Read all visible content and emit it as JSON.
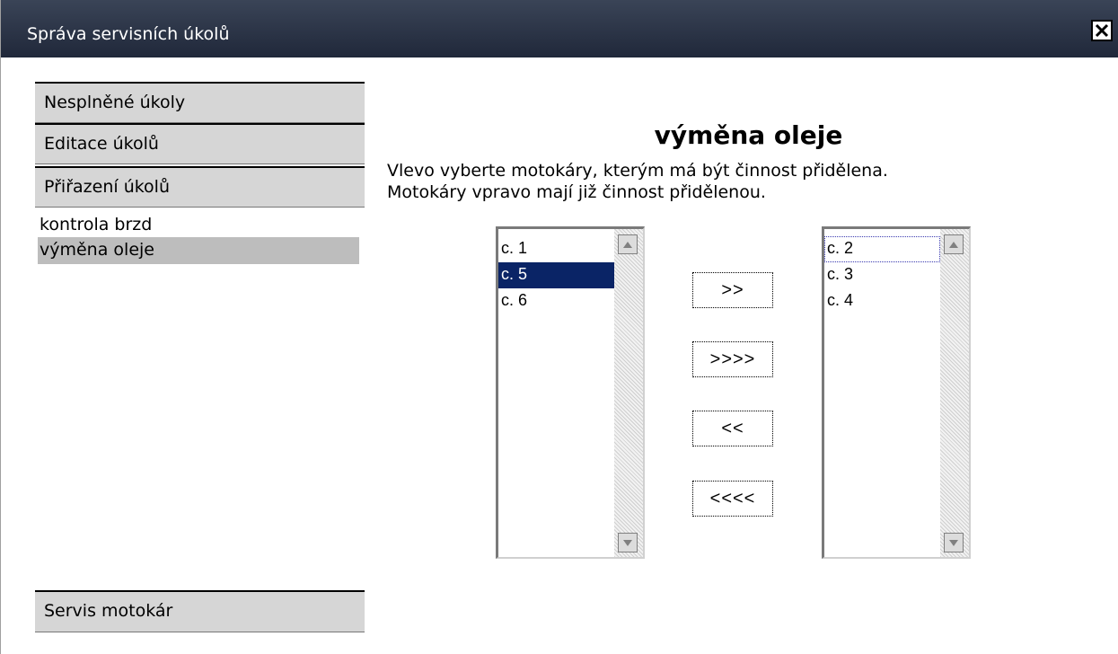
{
  "window": {
    "title": "Správa servisních úkolů"
  },
  "sidebar": {
    "items": [
      {
        "label": "Nesplněné úkoly"
      },
      {
        "label": "Editace úkolů"
      },
      {
        "label": "Přiřazení úkolů"
      }
    ],
    "subitems": [
      {
        "label": "kontrola brzd",
        "selected": false
      },
      {
        "label": "výměna oleje",
        "selected": true
      }
    ],
    "footer_item": {
      "label": "Servis motokár"
    }
  },
  "main": {
    "heading": "výměna oleje",
    "instruction_line1": "Vlevo vyberte motokáry, kterým má být činnost přidělena.",
    "instruction_line2": "Motokáry vpravo mají již činnost přidělenou.",
    "left_list": {
      "options": [
        {
          "label": "c. 1",
          "selected": false
        },
        {
          "label": "c. 5",
          "selected": true
        },
        {
          "label": "c. 6",
          "selected": false
        }
      ]
    },
    "right_list": {
      "options": [
        {
          "label": "c. 2",
          "focused": true
        },
        {
          "label": "c. 3",
          "focused": false
        },
        {
          "label": "c. 4",
          "focused": false
        }
      ]
    },
    "buttons": {
      "move_right": ">>",
      "move_all_right": ">>>>",
      "move_left": "<<",
      "move_all_left": "<<<<"
    }
  },
  "colors": {
    "titlebar": "#20283a",
    "nav_bg": "#d6d6d6",
    "selected_option": "#0a2466",
    "selected_subitem": "#bdbdbd"
  }
}
